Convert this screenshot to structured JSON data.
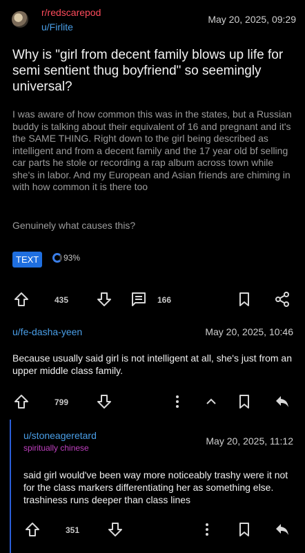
{
  "post": {
    "subreddit": "r/redscarepod",
    "author": "u/Firlite",
    "date": "May 20, 2025, 09:29",
    "title": "Why is \"girl from decent family blows up life for semi sentient thug boyfriend\" so seemingly universal?",
    "body_p1": "I was aware of how common this was in the states, but a Russian buddy is talking about their equivalent of 16 and pregnant and it's the SAME THING. Right down to the girl being described as intelligent and from a decent family and the 17 year old bf selling car parts he stole or recording a rap album across town while she's in labor. And my European and Asian friends are chiming in with how common it is there too",
    "body_p2": "Genuinely what causes this?",
    "tag": "TEXT",
    "upvote_ratio": "93%",
    "score": "435",
    "comments": "166"
  },
  "comments": [
    {
      "author": "u/fe-dasha-yeen",
      "date": "May 20, 2025, 10:46",
      "text": "Because usually said girl is not intelligent at all, she's just from an upper middle class family.",
      "score": "799"
    },
    {
      "author": "u/stoneageretard",
      "flair": "spiritually chinese",
      "date": "May 20, 2025, 11:12",
      "text": "said girl would've been way more noticeably trashy were it not for the class markers differentiating her as something else. trashiness runs deeper than class lines",
      "score": "351"
    }
  ],
  "colors": {
    "subreddit": "#ff4b5c",
    "username": "#4a9fe8",
    "tag_bg": "#1f6fe0",
    "flair": "#c040c0",
    "thread_line": "#2b5ed8"
  }
}
